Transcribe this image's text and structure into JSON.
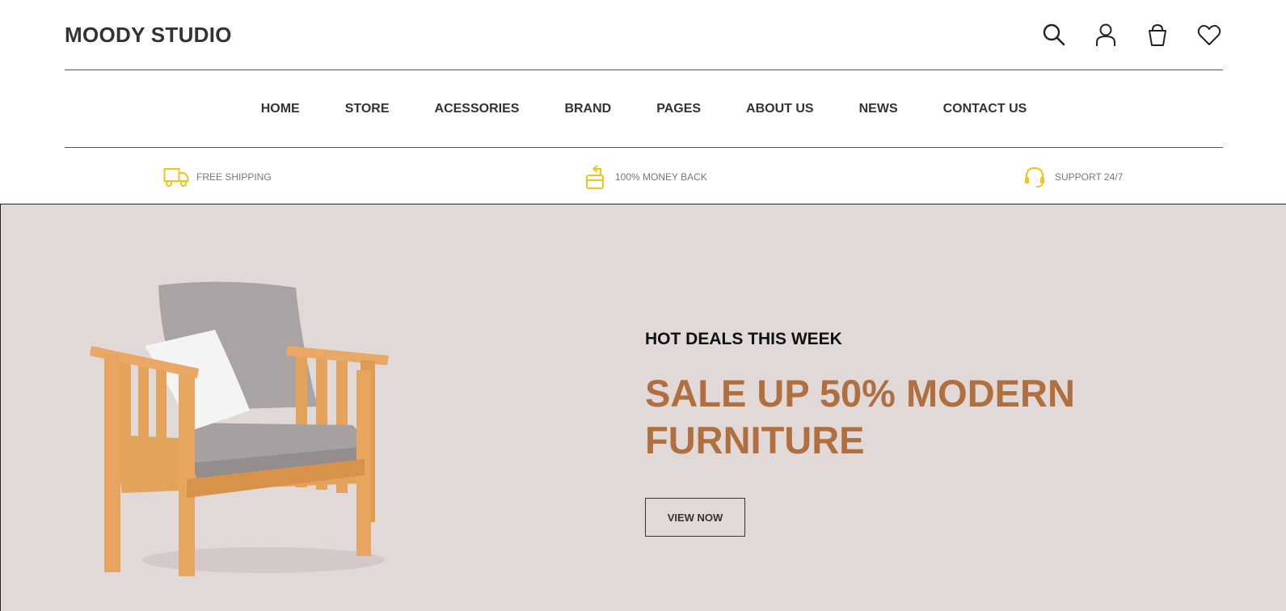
{
  "brand": {
    "name": "MOODY STUDIO"
  },
  "header_icons": [
    "search-icon",
    "user-icon",
    "cart-icon",
    "heart-icon"
  ],
  "nav": {
    "items": [
      "HOME",
      "STORE",
      "ACESSORIES",
      "BRAND",
      "PAGES",
      "ABOUT US",
      "NEWS",
      "CONTACT US"
    ]
  },
  "features": [
    {
      "icon": "truck-icon",
      "label": "FREE SHIPPING"
    },
    {
      "icon": "money-back-icon",
      "label": "100% MONEY BACK"
    },
    {
      "icon": "headset-icon",
      "label": "SUPPORT 24/7"
    }
  ],
  "hero": {
    "subtitle": "HOT DEALS THIS WEEK",
    "title_line1": "SALE UP 50% MODERN",
    "title_line2": "FURNITURE",
    "button": "VIEW NOW"
  },
  "colors": {
    "hero_bg": "#e1d9d8",
    "accent": "#b06f3e",
    "feature_icon": "#f0c419",
    "text_dark": "#333333"
  }
}
